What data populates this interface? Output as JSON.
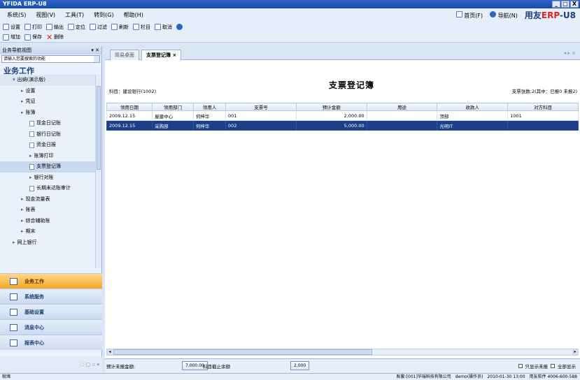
{
  "window": {
    "title": "YFIDA ERP-U8",
    "buttons": [
      "_",
      "□",
      "X"
    ]
  },
  "menu": [
    "系统(S)",
    "视图(V)",
    "工具(T)",
    "转到(G)",
    "帮助(H)"
  ],
  "top_right": {
    "home": "首页(F)",
    "nav": "导航(N)",
    "brand_prefix": "用友",
    "brand_erp": "ERP",
    "brand_suffix": "-U8"
  },
  "toolbar1": [
    "设置",
    "打印",
    "输出",
    "定位",
    "过滤",
    "刷新",
    "栏目",
    "取消"
  ],
  "toolbar2": [
    "增加",
    "保存",
    "删除"
  ],
  "nav": {
    "header": "业务导航视图",
    "search_placeholder": "请输入您要搜索的功能",
    "title": "业务工作",
    "tree": [
      {
        "label": "出纳(演示版)",
        "kind": "group",
        "indent": 0
      },
      {
        "label": "设置",
        "kind": "bullet",
        "indent": 1
      },
      {
        "label": "凭证",
        "kind": "bullet",
        "indent": 1
      },
      {
        "label": "账簿",
        "kind": "bullet",
        "indent": 1
      },
      {
        "label": "现金日记账",
        "kind": "page",
        "indent": 2
      },
      {
        "label": "银行日记账",
        "kind": "page",
        "indent": 2
      },
      {
        "label": "资金日报",
        "kind": "page",
        "indent": 2
      },
      {
        "label": "账簿打印",
        "kind": "bullet",
        "indent": 2
      },
      {
        "label": "支票登记簿",
        "kind": "page",
        "indent": 2,
        "selected": true
      },
      {
        "label": "银行对账",
        "kind": "bullet",
        "indent": 2
      },
      {
        "label": "长期未达账审计",
        "kind": "page",
        "indent": 2
      },
      {
        "label": "现金流量表",
        "kind": "bullet",
        "indent": 1
      },
      {
        "label": "账表",
        "kind": "bullet",
        "indent": 1
      },
      {
        "label": "综合辅助账",
        "kind": "bullet",
        "indent": 1
      },
      {
        "label": "期末",
        "kind": "bullet",
        "indent": 1
      },
      {
        "label": "网上银行",
        "kind": "bullet",
        "indent": 0
      }
    ],
    "modules": [
      "业务工作",
      "系统服务",
      "基础设置",
      "消息中心",
      "报表中心"
    ]
  },
  "tabs": [
    "简易桌面",
    "支票登记簿"
  ],
  "document": {
    "title": "支票登记簿",
    "subject": "科目：建设银行(1002)",
    "status": "支票张数:2(其中：已报0 未报2)",
    "columns": [
      "领用日期",
      "领用部门",
      "领用人",
      "支票号",
      "预计金额",
      "用途",
      "收款人",
      "对方科目"
    ],
    "rows": [
      [
        "2009.12.15",
        "屋建中心",
        "何梓华",
        "001",
        "2,000.00",
        "",
        "顶部",
        "1001"
      ],
      [
        "2009.12.15",
        "采购部",
        "何梓华",
        "002",
        "5,000.00",
        "",
        "光明IT",
        ""
      ]
    ],
    "selected_row": 1
  },
  "bottom": {
    "unreimbursed": "预计未报金额:",
    "btn1": "7,000.00",
    "text2": "科目截止余额",
    "btn2": "2,000",
    "check_single": "只显示未报",
    "check_all": "全部显示"
  },
  "statusbar": {
    "left": "就绪",
    "account": "账套:[001]华瑞科技有限公司",
    "user": "demo(操作员)",
    "date": "2010-01-30 13:00",
    "service": "用友软件 4006-600-588"
  }
}
